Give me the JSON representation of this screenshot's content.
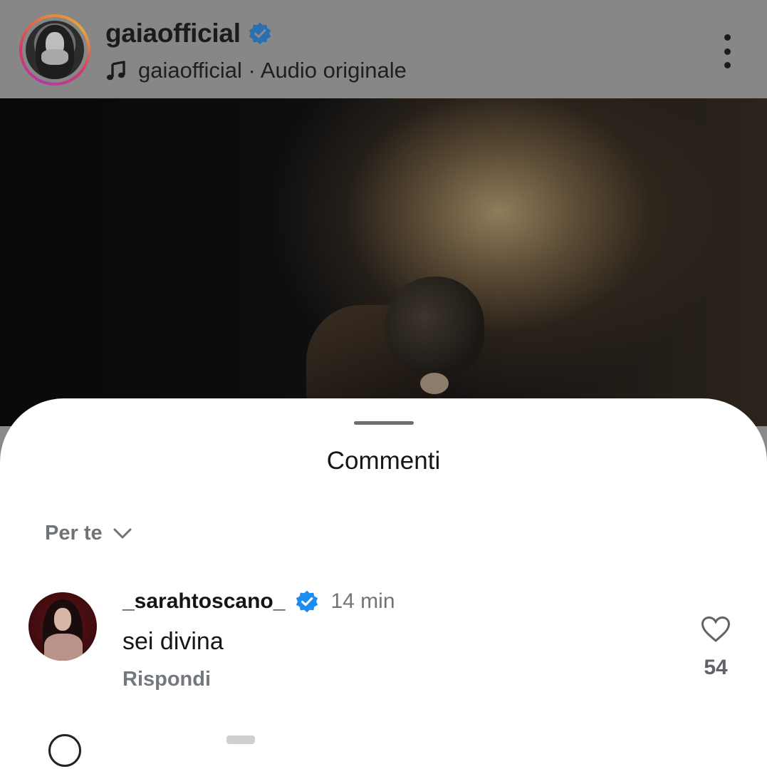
{
  "header": {
    "username": "gaiaofficial",
    "audio_owner": "gaiaofficial",
    "audio_separator": " · ",
    "audio_label": "Audio originale",
    "icons": [
      "verified-badge-icon",
      "music-note-icon",
      "more-vertical-icon"
    ]
  },
  "sheet": {
    "title": "Commenti",
    "sort_label": "Per te",
    "comments": [
      {
        "username": "_sarahtoscano_",
        "verified": true,
        "time": "14 min",
        "text": "sei divina",
        "reply_label": "Rispondi",
        "likes": "54"
      }
    ]
  },
  "colors": {
    "verified_blue": "#1d8cf0",
    "sheet_bg": "#ffffff",
    "dim_overlay": "#878787",
    "secondary_text": "#737880"
  }
}
